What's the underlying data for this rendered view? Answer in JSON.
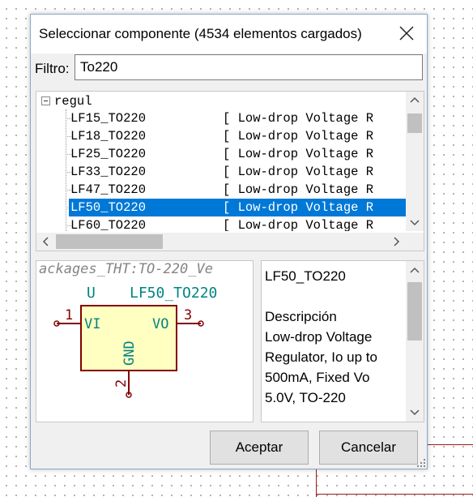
{
  "dialog": {
    "title": "Seleccionar componente (4534 elementos cargados)",
    "filter_label": "Filtro:",
    "filter_value": "To220"
  },
  "tree": {
    "root_label": "regul",
    "rows": [
      {
        "name": "LF15_TO220",
        "desc": "[ Low-drop Voltage R"
      },
      {
        "name": "LF18_TO220",
        "desc": "[ Low-drop Voltage R"
      },
      {
        "name": "LF25_TO220",
        "desc": "[ Low-drop Voltage R"
      },
      {
        "name": "LF33_TO220",
        "desc": "[ Low-drop Voltage R"
      },
      {
        "name": "LF47_TO220",
        "desc": "[ Low-drop Voltage R"
      },
      {
        "name": "LF50_TO220",
        "desc": "[ Low-drop Voltage R",
        "selected": true
      },
      {
        "name": "LF60_TO220",
        "desc": "[ Low-drop Voltage R"
      }
    ]
  },
  "symbol": {
    "footprint_text": "ackages_THT:TO-220_Ve",
    "reference": "U",
    "value": "LF50_TO220",
    "pin1_num": "1",
    "pin1_name": "VI",
    "pin3_num": "3",
    "pin3_name": "VO",
    "pin2_num": "2",
    "pin2_name": "GND"
  },
  "info": {
    "name": "LF50_TO220",
    "desc_heading": "Descripción",
    "desc_lines": [
      "Low-drop Voltage",
      "Regulator, Io up to",
      "500mA, Fixed Vo",
      "5.0V, TO-220"
    ]
  },
  "buttons": {
    "accept": "Aceptar",
    "cancel": "Cancelar"
  },
  "colors": {
    "selection": "#0078d7",
    "symbol_outline": "#840000",
    "symbol_fill": "#ffffc2",
    "symbol_text": "#008484",
    "wire": "#9c1a1a"
  }
}
